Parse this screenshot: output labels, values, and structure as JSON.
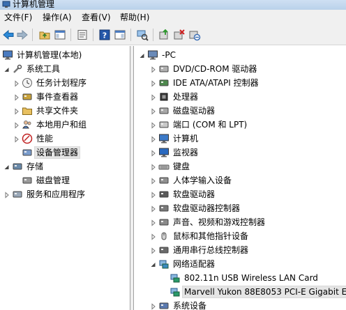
{
  "window": {
    "title": "计算机管理"
  },
  "menu": [
    "文件(F)",
    "操作(A)",
    "查看(V)",
    "帮助(H)"
  ],
  "toolbar": [
    {
      "name": "back-arrow-icon"
    },
    {
      "name": "forward-arrow-icon"
    },
    {
      "name": "up-folder-icon"
    },
    {
      "name": "show-hide-tree-icon"
    },
    {
      "name": "properties-icon"
    },
    {
      "name": "help-icon"
    },
    {
      "name": "action-pane-icon"
    },
    {
      "name": "scan-hardware-icon"
    },
    {
      "name": "update-driver-icon"
    },
    {
      "name": "uninstall-device-icon"
    },
    {
      "name": "disable-device-icon"
    }
  ],
  "left_tree": [
    {
      "label": "计算机管理(本地)",
      "icon": "computer-management-icon",
      "level": 0,
      "arrow": "none"
    },
    {
      "label": "系统工具",
      "icon": "tools-icon",
      "level": 1,
      "arrow": "expanded"
    },
    {
      "label": "任务计划程序",
      "icon": "clock-icon",
      "level": 2,
      "arrow": "collapsed"
    },
    {
      "label": "事件查看器",
      "icon": "event-viewer-icon",
      "level": 2,
      "arrow": "collapsed"
    },
    {
      "label": "共享文件夹",
      "icon": "shared-folder-icon",
      "level": 2,
      "arrow": "collapsed"
    },
    {
      "label": "本地用户和组",
      "icon": "users-icon",
      "level": 2,
      "arrow": "collapsed"
    },
    {
      "label": "性能",
      "icon": "performance-icon",
      "level": 2,
      "arrow": "collapsed"
    },
    {
      "label": "设备管理器",
      "icon": "device-manager-icon",
      "level": 2,
      "arrow": "none",
      "selected": true
    },
    {
      "label": "存储",
      "icon": "storage-icon",
      "level": 1,
      "arrow": "expanded"
    },
    {
      "label": "磁盘管理",
      "icon": "disk-management-icon",
      "level": 2,
      "arrow": "none"
    },
    {
      "label": "服务和应用程序",
      "icon": "services-icon",
      "level": 1,
      "arrow": "collapsed"
    }
  ],
  "right_tree": [
    {
      "label": "-PC",
      "icon": "pc-icon",
      "level": 0,
      "arrow": "expanded"
    },
    {
      "label": "DVD/CD-ROM 驱动器",
      "icon": "dvd-drive-icon",
      "level": 1,
      "arrow": "collapsed"
    },
    {
      "label": "IDE ATA/ATAPI 控制器",
      "icon": "ide-controller-icon",
      "level": 1,
      "arrow": "collapsed"
    },
    {
      "label": "处理器",
      "icon": "processor-icon",
      "level": 1,
      "arrow": "collapsed"
    },
    {
      "label": "磁盘驱动器",
      "icon": "disk-drive-icon",
      "level": 1,
      "arrow": "collapsed"
    },
    {
      "label": "端口 (COM 和 LPT)",
      "icon": "port-icon",
      "level": 1,
      "arrow": "collapsed"
    },
    {
      "label": "计算机",
      "icon": "computer-icon",
      "level": 1,
      "arrow": "collapsed"
    },
    {
      "label": "监视器",
      "icon": "monitor-icon",
      "level": 1,
      "arrow": "collapsed"
    },
    {
      "label": "键盘",
      "icon": "keyboard-icon",
      "level": 1,
      "arrow": "collapsed"
    },
    {
      "label": "人体学输入设备",
      "icon": "hid-icon",
      "level": 1,
      "arrow": "collapsed"
    },
    {
      "label": "软盘驱动器",
      "icon": "floppy-drive-icon",
      "level": 1,
      "arrow": "collapsed"
    },
    {
      "label": "软盘驱动器控制器",
      "icon": "floppy-controller-icon",
      "level": 1,
      "arrow": "collapsed"
    },
    {
      "label": "声音、视频和游戏控制器",
      "icon": "sound-icon",
      "level": 1,
      "arrow": "collapsed"
    },
    {
      "label": "鼠标和其他指针设备",
      "icon": "mouse-icon",
      "level": 1,
      "arrow": "collapsed"
    },
    {
      "label": "通用串行总线控制器",
      "icon": "usb-icon",
      "level": 1,
      "arrow": "collapsed"
    },
    {
      "label": "网络适配器",
      "icon": "network-adapter-icon",
      "level": 1,
      "arrow": "expanded"
    },
    {
      "label": "802.11n USB Wireless LAN Card",
      "icon": "network-card-icon",
      "level": 2,
      "arrow": "none"
    },
    {
      "label": "Marvell Yukon 88E8053 PCI-E Gigabit E",
      "icon": "network-card-icon",
      "level": 2,
      "arrow": "none",
      "selected": true
    },
    {
      "label": "系统设备",
      "icon": "system-devices-icon",
      "level": 1,
      "arrow": "collapsed"
    }
  ]
}
